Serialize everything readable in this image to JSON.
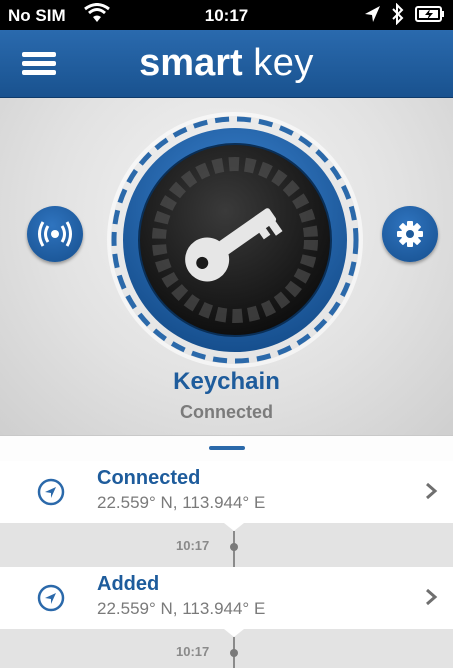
{
  "status_bar": {
    "carrier": "No SIM",
    "time": "10:17"
  },
  "header": {
    "brand_bold": "smart",
    "brand_light": "key",
    "menu_icon": "hamburger-menu-icon"
  },
  "device": {
    "name": "Keychain",
    "status": "Connected",
    "icons": {
      "left_button": "broadcast-signal-icon",
      "right_button": "gear-icon",
      "center": "key-icon"
    }
  },
  "events": [
    {
      "title": "Connected",
      "coords": "22.559° N, 113.944° E",
      "time": "10:17"
    },
    {
      "title": "Added",
      "coords": "22.559° N, 113.944° E",
      "time": "10:17"
    }
  ],
  "colors": {
    "brand_blue": "#1e5c9c",
    "navbar_blue": "#2a6aae",
    "hero_gray": "#e2e2e2"
  }
}
